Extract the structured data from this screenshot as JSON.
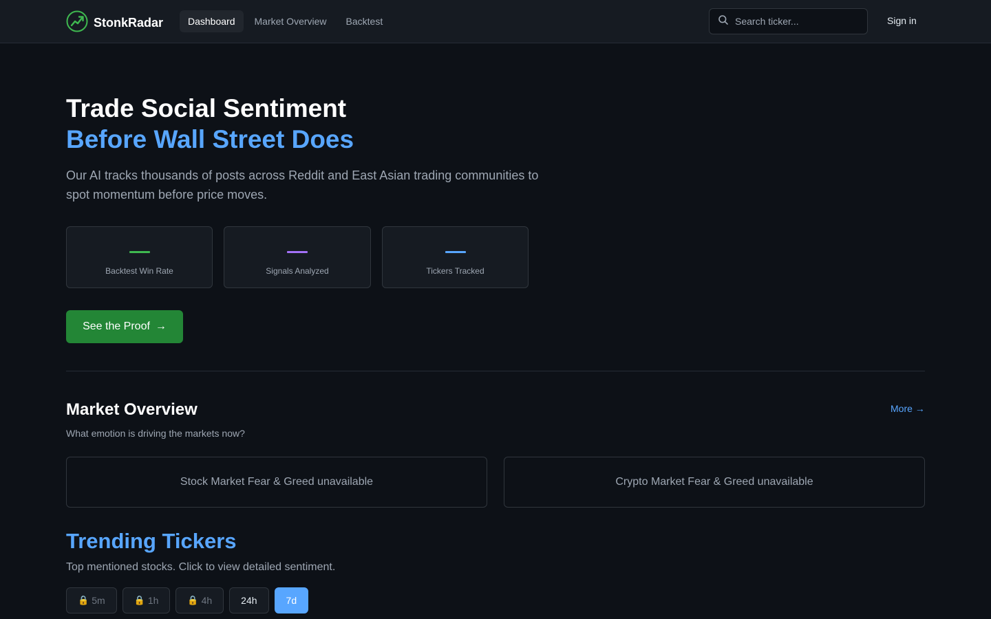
{
  "app": {
    "name": "StonkRadar"
  },
  "nav": [
    {
      "label": "Dashboard",
      "active": true
    },
    {
      "label": "Market Overview",
      "active": false
    },
    {
      "label": "Backtest",
      "active": false
    }
  ],
  "search": {
    "placeholder": "Search ticker..."
  },
  "header": {
    "signin_label": "Sign in"
  },
  "hero": {
    "title_line1": "Trade Social Sentiment",
    "title_line2": "Before Wall Street Does",
    "description": "Our AI tracks thousands of posts across Reddit and East Asian trading communities to spot momentum before price moves.",
    "stats": [
      {
        "label": "Backtest Win Rate",
        "color": "#3fb950"
      },
      {
        "label": "Signals Analyzed",
        "color": "#a371f7"
      },
      {
        "label": "Tickers Tracked",
        "color": "#58a6ff"
      }
    ],
    "cta_label": "See the Proof",
    "cta_arrow": "→"
  },
  "market_overview": {
    "title": "Market Overview",
    "subtitle": "What emotion is driving the markets now?",
    "more_label": "More →",
    "stock_fg": "Stock Market Fear & Greed unavailable",
    "crypto_fg": "Crypto Market Fear & Greed unavailable"
  },
  "trending": {
    "title": "Trending Tickers",
    "subtitle": "Top mentioned stocks. Click to view detailed sentiment.",
    "timeframes": [
      {
        "label": "5m",
        "locked": true,
        "active": false
      },
      {
        "label": "1h",
        "locked": true,
        "active": false
      },
      {
        "label": "4h",
        "locked": true,
        "active": false
      },
      {
        "label": "24h",
        "locked": false,
        "active": false
      },
      {
        "label": "7d",
        "locked": false,
        "active": true
      }
    ]
  },
  "colors": {
    "background": "#0d1117",
    "accent": "#58a6ff",
    "cta": "#238636",
    "logo": "#3fb950"
  }
}
